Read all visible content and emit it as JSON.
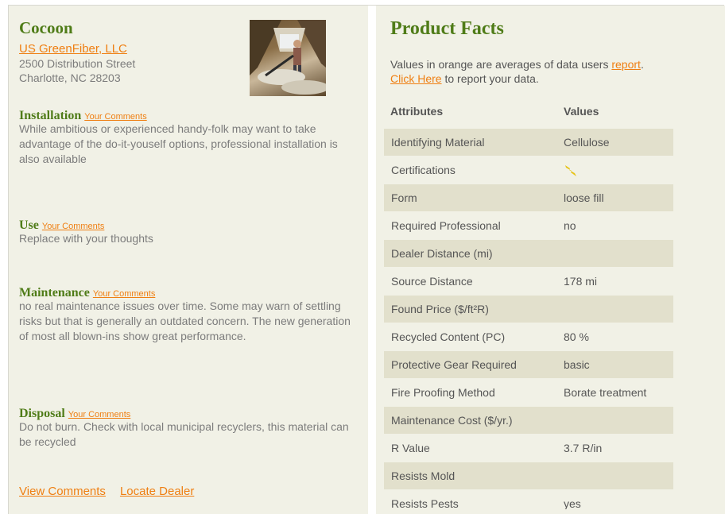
{
  "product": {
    "name": "Cocoon",
    "company_link": "US GreenFiber, LLC",
    "address_line1": "2500 Distribution Street",
    "address_line2": "Charlotte, NC 28203"
  },
  "sections": {
    "installation": {
      "title": "Installation",
      "comment_link": "Your Comments",
      "body": "While ambitious or experienced handy-folk may want to take advantage of the do-it-youself options, professional installation is also available"
    },
    "use": {
      "title": "Use",
      "comment_link": "Your Comments",
      "body": "Replace with your thoughts"
    },
    "maintenance": {
      "title": "Maintenance",
      "comment_link": "Your Comments",
      "body": "no real maintenance issues over time. Some may warn of settling risks but that is generally an outdated concern. The new generation of most all blown-ins show great performance."
    },
    "disposal": {
      "title": "Disposal",
      "comment_link": "Your Comments",
      "body": "Do not burn. Check with local municipal recyclers, this material can be recycled"
    }
  },
  "bottom_links": {
    "view_comments": "View Comments",
    "locate_dealer": "Locate Dealer"
  },
  "facts": {
    "title": "Product Facts",
    "note_prefix": "Values in orange are averages of data users ",
    "note_report_link": "report",
    "note_period": ".",
    "note_click_link": "Click Here",
    "note_suffix": " to report your data.",
    "col_attributes": "Attributes",
    "col_values": "Values",
    "rows": [
      {
        "attr": "Identifying Material",
        "value": "Cellulose"
      },
      {
        "attr": "Certifications",
        "value": ""
      },
      {
        "attr": "Form",
        "value": "loose fill"
      },
      {
        "attr": "Required Professional",
        "value": "no"
      },
      {
        "attr": "Dealer Distance (mi)",
        "value": ""
      },
      {
        "attr": "Source Distance",
        "value": "178 mi"
      },
      {
        "attr": "Found Price ($/ft²R)",
        "value": ""
      },
      {
        "attr": "Recycled Content (PC)",
        "value": "80 %"
      },
      {
        "attr": "Protective Gear Required",
        "value": "basic"
      },
      {
        "attr": "Fire Proofing Method",
        "value": "Borate treatment"
      },
      {
        "attr": "Maintenance Cost ($/yr.)",
        "value": ""
      },
      {
        "attr": "R Value",
        "value": "3.7 R/in"
      },
      {
        "attr": "Resists Mold",
        "value": ""
      },
      {
        "attr": "Resists Pests",
        "value": "yes"
      }
    ]
  },
  "colors": {
    "background": "#f1f1e6",
    "row_shade": "#e2e0cc",
    "title_green": "#4f7c18",
    "link_orange": "#ef7f12",
    "text_gray": "#7c7c7c"
  },
  "icons": {
    "certification": "lightning-bolt-icon"
  }
}
